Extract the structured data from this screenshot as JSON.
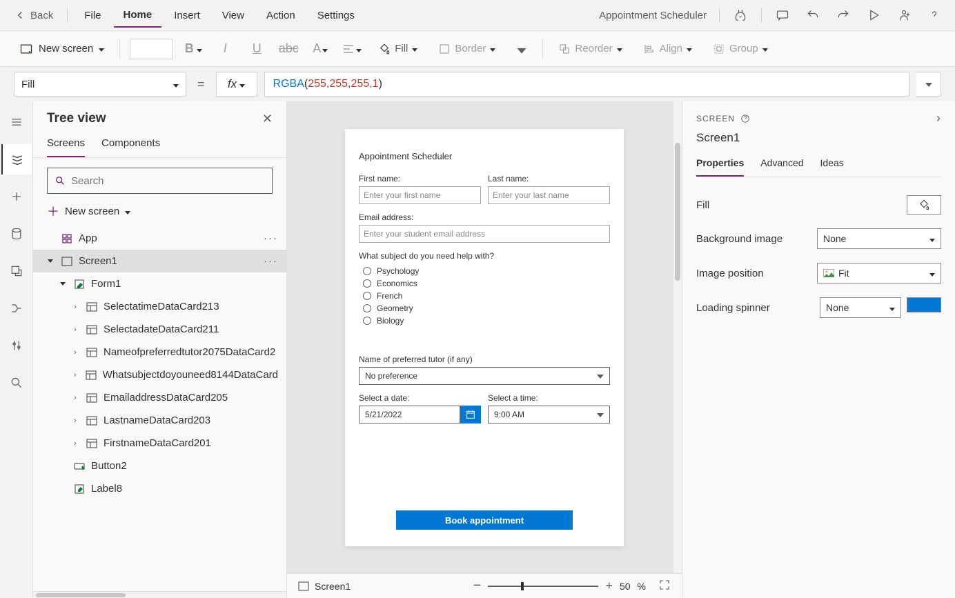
{
  "topmenu": {
    "back": "Back",
    "items": [
      "File",
      "Home",
      "Insert",
      "View",
      "Action",
      "Settings"
    ],
    "app_title": "Appointment Scheduler"
  },
  "ribbon": {
    "new_screen": "New screen",
    "fill": "Fill",
    "border": "Border",
    "reorder": "Reorder",
    "align": "Align",
    "group": "Group"
  },
  "formula": {
    "property": "Fill",
    "fx": "fx",
    "fn": "RGBA",
    "args": [
      "255",
      "255",
      "255",
      "1"
    ]
  },
  "tree": {
    "title": "Tree view",
    "tabs": [
      "Screens",
      "Components"
    ],
    "search_placeholder": "Search",
    "new_screen": "New screen",
    "items": [
      {
        "label": "App",
        "indent": 0,
        "icon": "app",
        "chev": "",
        "dots": true
      },
      {
        "label": "Screen1",
        "indent": 1,
        "icon": "screen",
        "chev": "down",
        "dots": true,
        "selected": true
      },
      {
        "label": "Form1",
        "indent": 2,
        "icon": "form",
        "chev": "down"
      },
      {
        "label": "SelectatimeDataCard213",
        "indent": 3,
        "icon": "card",
        "chev": "right"
      },
      {
        "label": "SelectadateDataCard211",
        "indent": 3,
        "icon": "card",
        "chev": "right"
      },
      {
        "label": "Nameofpreferredtutor2075DataCard2",
        "indent": 3,
        "icon": "card",
        "chev": "right"
      },
      {
        "label": "Whatsubjectdoyouneed8144DataCard",
        "indent": 3,
        "icon": "card",
        "chev": "right"
      },
      {
        "label": "EmailaddressDataCard205",
        "indent": 3,
        "icon": "card",
        "chev": "right"
      },
      {
        "label": "LastnameDataCard203",
        "indent": 3,
        "icon": "card",
        "chev": "right"
      },
      {
        "label": "FirstnameDataCard201",
        "indent": 3,
        "icon": "card",
        "chev": "right"
      },
      {
        "label": "Button2",
        "indent": 2,
        "icon": "button",
        "chev": ""
      },
      {
        "label": "Label8",
        "indent": 2,
        "icon": "label",
        "chev": ""
      }
    ]
  },
  "app": {
    "title": "Appointment Scheduler",
    "first_name_label": "First name:",
    "first_name_ph": "Enter your first name",
    "last_name_label": "Last name:",
    "last_name_ph": "Enter your last name",
    "email_label": "Email address:",
    "email_ph": "Enter your student email address",
    "subject_label": "What subject do you need help with?",
    "subjects": [
      "Psychology",
      "Economics",
      "French",
      "Geometry",
      "Biology"
    ],
    "tutor_label": "Name of preferred tutor (if any)",
    "tutor_value": "No preference",
    "date_label": "Select a date:",
    "date_value": "5/21/2022",
    "time_label": "Select a time:",
    "time_value": "9:00 AM",
    "book": "Book appointment"
  },
  "status": {
    "screen": "Screen1",
    "zoom": "50",
    "percent": "%"
  },
  "props": {
    "header": "SCREEN",
    "name": "Screen1",
    "tabs": [
      "Properties",
      "Advanced",
      "Ideas"
    ],
    "fill": "Fill",
    "bg_image": "Background image",
    "bg_image_val": "None",
    "img_pos": "Image position",
    "img_pos_val": "Fit",
    "spinner": "Loading spinner",
    "spinner_val": "None"
  }
}
